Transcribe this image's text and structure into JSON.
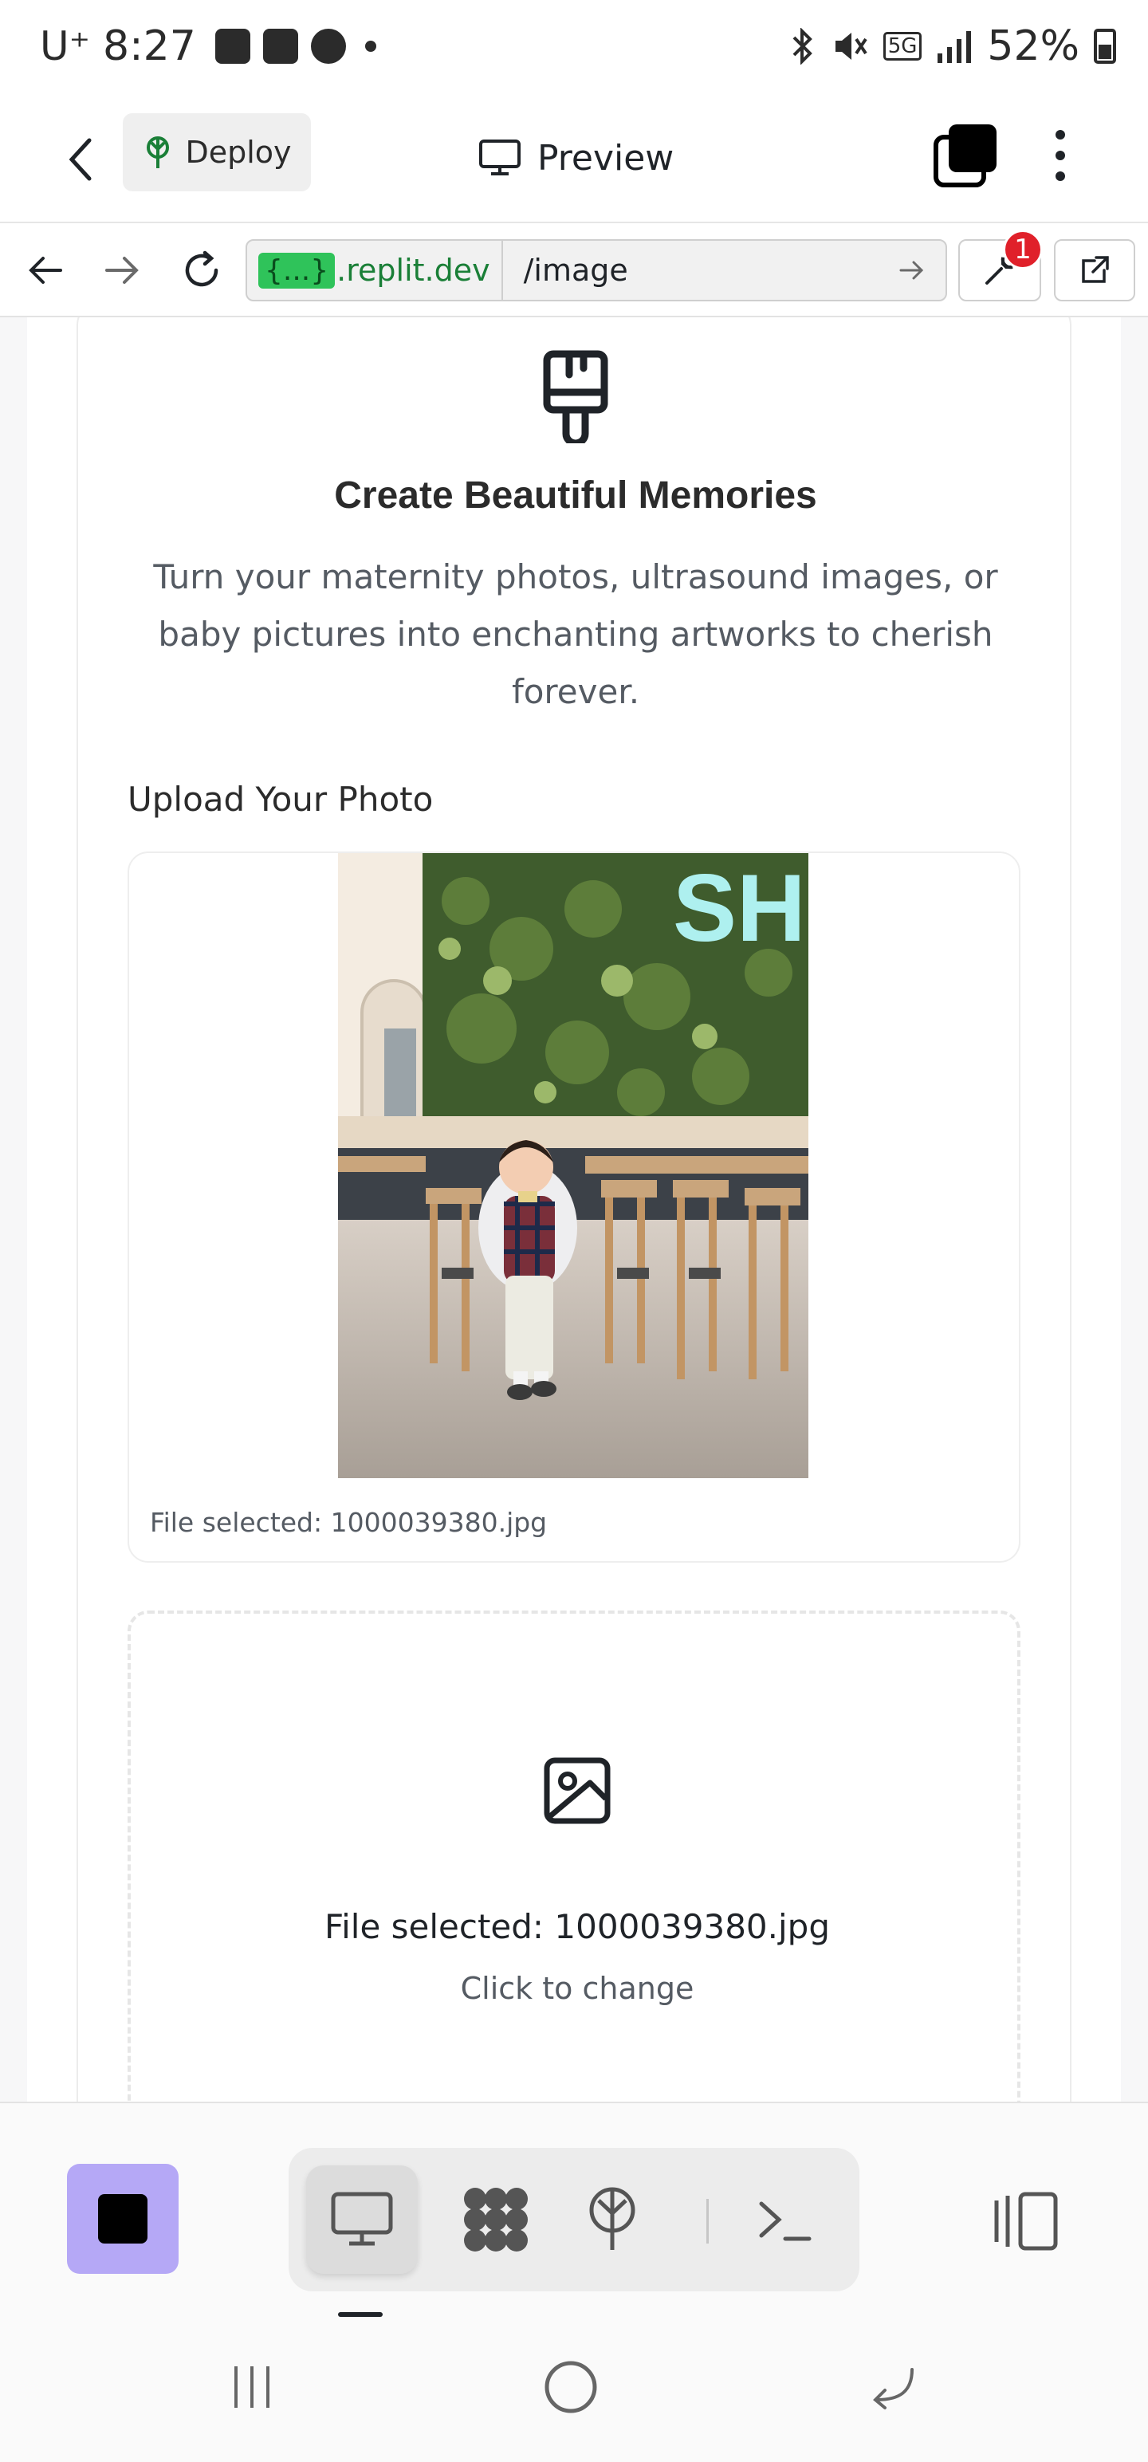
{
  "status_bar": {
    "carrier": "U⁺",
    "time": "8:27",
    "battery": "52%",
    "network": "5G"
  },
  "header": {
    "deploy_label": "Deploy",
    "preview_label": "Preview"
  },
  "url_bar": {
    "domain_badge": "{...}",
    "domain": ".replit.dev",
    "path": "/image",
    "notification_count": "1"
  },
  "card": {
    "title": "Create Beautiful Memories",
    "description": "Turn your maternity photos, ultrasound images, or baby pictures into enchanting artworks to cherish forever.",
    "upload_label": "Upload Your Photo",
    "preview_file_text": "File selected: 1000039380.jpg",
    "drop_file_text": "File selected: 1000039380.jpg",
    "drop_hint": "Click to change"
  },
  "colors": {
    "stop_button": "#b5a8f6",
    "domain_badge": "#2fc35a",
    "notification": "#e0202a"
  }
}
